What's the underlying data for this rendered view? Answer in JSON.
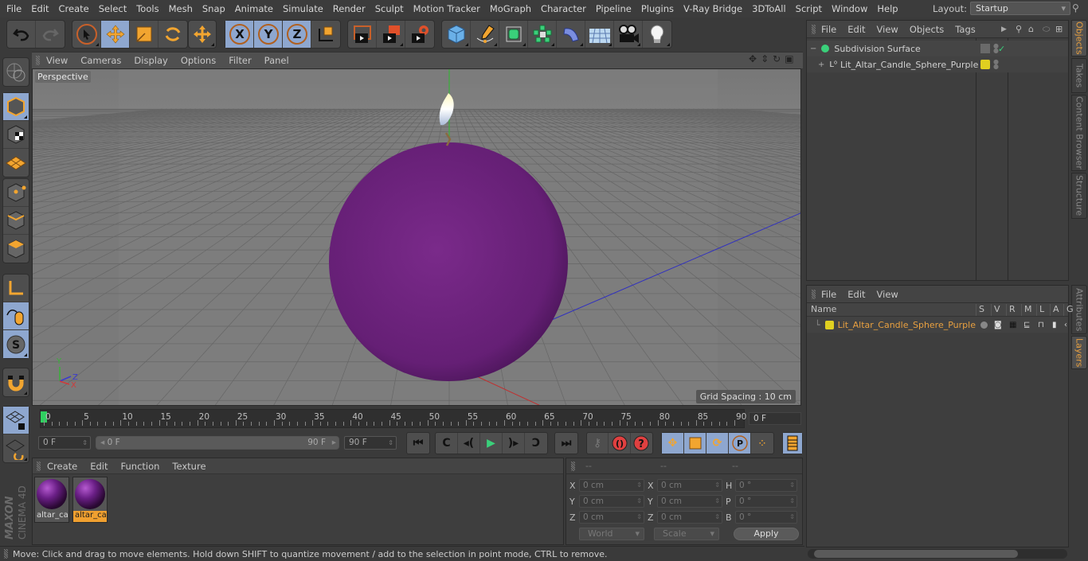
{
  "menubar": {
    "items": [
      "File",
      "Edit",
      "Create",
      "Select",
      "Tools",
      "Mesh",
      "Snap",
      "Animate",
      "Simulate",
      "Render",
      "Sculpt",
      "Motion Tracker",
      "MoGraph",
      "Character",
      "Pipeline",
      "Plugins",
      "V-Ray Bridge",
      "3DToAll",
      "Script",
      "Window",
      "Help"
    ],
    "layout_label": "Layout:",
    "layout_value": "Startup"
  },
  "toolbar": {
    "undo": "undo-icon",
    "redo": "redo-icon",
    "tools": [
      "live-selection",
      "move",
      "scale",
      "rotate",
      "move-axis"
    ],
    "axes": [
      "X",
      "Y",
      "Z"
    ],
    "coord_system": "world-coordinates",
    "render": [
      "render-view",
      "render-picture-viewer",
      "render-settings"
    ],
    "objects": [
      "cube",
      "pen",
      "subdivision-surface",
      "array",
      "bend-deformer",
      "floor",
      "camera",
      "light"
    ]
  },
  "left_toolbar": {
    "items": [
      "make-editable",
      "model-mode",
      "texture-mode",
      "workplane-mode",
      "points-mode",
      "edges-mode",
      "polygons-mode",
      "axis-mode",
      "tweak-mode",
      "solo-mode",
      "snap",
      "lock-workplane",
      "workplane-align"
    ]
  },
  "viewport": {
    "menu": [
      "View",
      "Cameras",
      "Display",
      "Options",
      "Filter",
      "Panel"
    ],
    "camera_label": "Perspective",
    "grid_spacing": "Grid Spacing : 10 cm",
    "axis_labels": {
      "x": "X",
      "y": "Y",
      "z": "Z"
    },
    "colors": {
      "background": "#808080",
      "sphere": "#6a1f7a",
      "grid": "#6a6a6a"
    }
  },
  "timeline": {
    "ticks": [
      "0",
      "5",
      "10",
      "15",
      "20",
      "25",
      "30",
      "35",
      "40",
      "45",
      "50",
      "55",
      "60",
      "65",
      "70",
      "75",
      "80",
      "85",
      "90"
    ],
    "current_frame": "0 F"
  },
  "transport": {
    "start_frame": "0 F",
    "range_start": "0 F",
    "range_end": "90 F",
    "end_frame": "90 F"
  },
  "materials": {
    "menu": [
      "Create",
      "Edit",
      "Function",
      "Texture"
    ],
    "items": [
      {
        "name": "altar_cai",
        "selected": false
      },
      {
        "name": "altar_cai",
        "selected": true
      }
    ]
  },
  "coordinates": {
    "headers": [
      "--",
      "--",
      "--"
    ],
    "rows": [
      {
        "a": "X",
        "pos": "0 cm",
        "b": "X",
        "size": "0 cm",
        "c": "H",
        "rot": "0 °"
      },
      {
        "a": "Y",
        "pos": "0 cm",
        "b": "Y",
        "size": "0 cm",
        "c": "P",
        "rot": "0 °"
      },
      {
        "a": "Z",
        "pos": "0 cm",
        "b": "Z",
        "size": "0 cm",
        "c": "B",
        "rot": "0 °"
      }
    ],
    "mode": "World",
    "size_mode": "Scale",
    "apply": "Apply"
  },
  "status": {
    "text": "Move: Click and drag to move elements. Hold down SHIFT to quantize movement / add to the selection in point mode, CTRL to remove."
  },
  "objects_panel": {
    "menu": [
      "File",
      "Edit",
      "View",
      "Objects",
      "Tags"
    ],
    "items": [
      {
        "name": "Subdivision Surface",
        "expand": "−"
      },
      {
        "name": "Lit_Altar_Candle_Sphere_Purple",
        "expand": "+"
      }
    ]
  },
  "layers_panel": {
    "menu": [
      "File",
      "Edit",
      "View"
    ],
    "columns": [
      "Name",
      "S",
      "V",
      "R",
      "M",
      "L",
      "A",
      "G"
    ],
    "items": [
      {
        "name": "Lit_Altar_Candle_Sphere_Purple",
        "color": "#e0d020"
      }
    ]
  },
  "side_tabs": {
    "top": [
      "Objects",
      "Takes",
      "Content Browser",
      "Structure"
    ],
    "bottom": [
      "Attributes",
      "Layers"
    ]
  },
  "branding": {
    "maxon": "MAXON",
    "product": "CINEMA 4D"
  },
  "colors": {
    "accent": "#e8a040",
    "selected_button": "#8ea7cf",
    "layer_color": "#e0d020"
  }
}
